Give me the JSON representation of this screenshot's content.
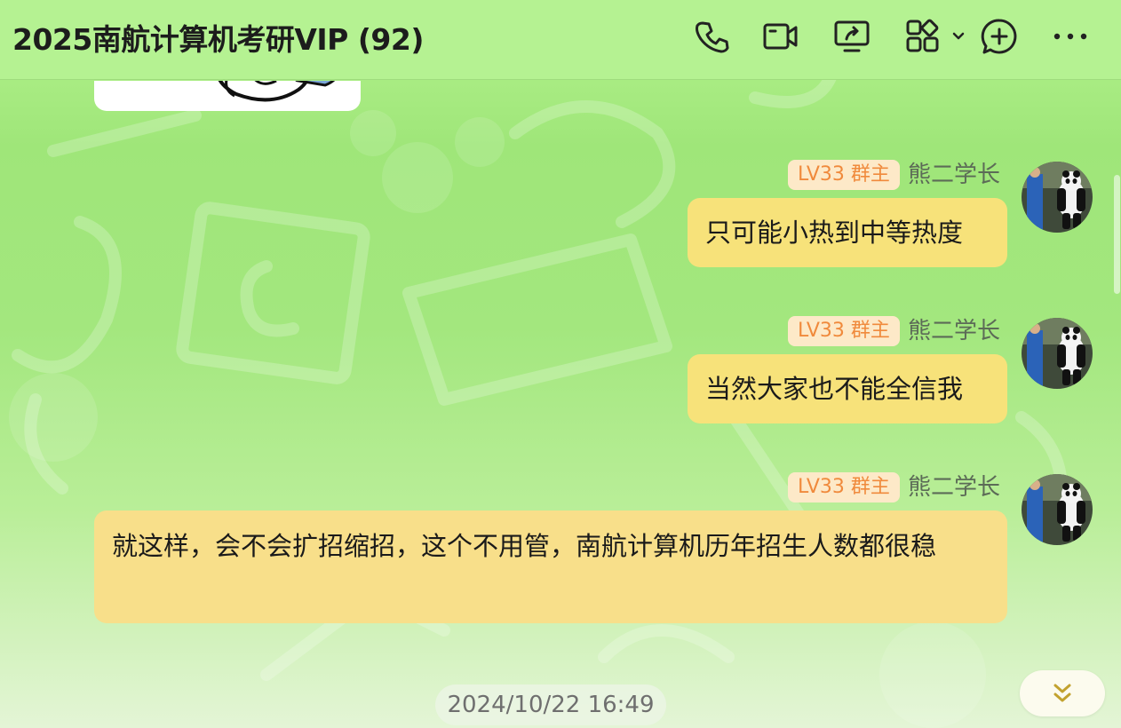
{
  "header": {
    "title": "2025南航计算机考研VIP (92)"
  },
  "header_icons": [
    "phone-icon",
    "video-camera-icon",
    "screen-share-icon",
    "apps-icon",
    "chevron-down-icon",
    "add-chat-icon",
    "more-icon"
  ],
  "messages": [
    {
      "badge": "LV33 群主",
      "sender": "熊二学长",
      "text": "只可能小热到中等热度"
    },
    {
      "badge": "LV33 群主",
      "sender": "熊二学长",
      "text": "当然大家也不能全信我"
    },
    {
      "badge": "LV33 群主",
      "sender": "熊二学长",
      "text": "就这样，会不会扩招缩招，这个不用管，南航计算机历年招生人数都很稳"
    }
  ],
  "timestamp": "2024/10/22 16:49",
  "colors": {
    "header_bg": "#b5f292",
    "bubble": "#f7e27a",
    "badge_text": "#f08a3c",
    "badge_bg": "#fde9c8",
    "scroll_chevron": "#c2a22e"
  }
}
